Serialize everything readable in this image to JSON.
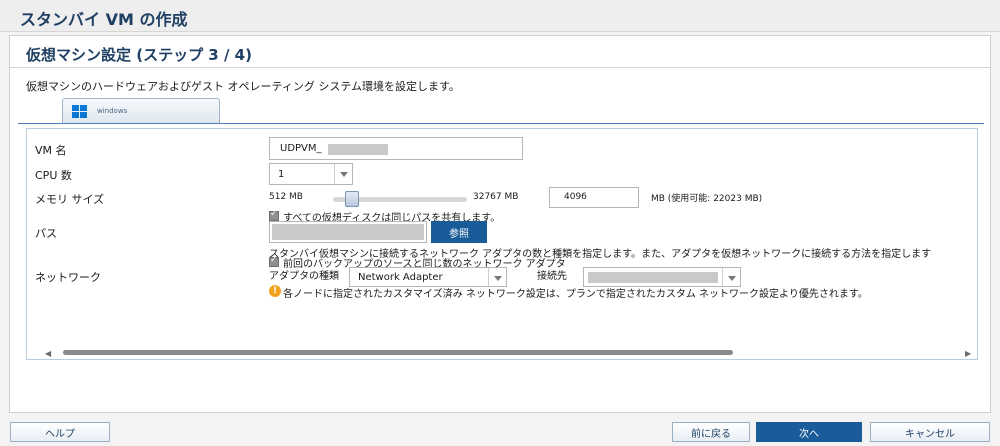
{
  "window": {
    "title": "スタンバイ VM の作成"
  },
  "step": {
    "title": "仮想マシン設定 (ステップ 3 / 4)",
    "description": "仮想マシンのハードウェアおよびゲスト オペレーティング システム環境を設定します。"
  },
  "os_tab": {
    "label": "windows",
    "icon": "windows-icon"
  },
  "form": {
    "vm_name": {
      "label": "VM 名",
      "value": "UDPVM_"
    },
    "cpu": {
      "label": "CPU 数",
      "value": "1"
    },
    "memory": {
      "label": "メモリ サイズ",
      "min": "512 MB",
      "max": "32767 MB",
      "value": "4096",
      "available": "MB (使用可能: 22023 MB)",
      "slider_level_mb": 4096
    },
    "share_path": {
      "label": "すべての仮想ディスクは同じパスを共有します。",
      "checked": true
    },
    "path": {
      "label": "パス",
      "browse": "参照"
    },
    "network": {
      "label": "ネットワーク",
      "description": "スタンバイ仮想マシンに接続するネットワーク アダプタの数と種類を指定します。また、アダプタを仮想ネットワークに接続する方法を指定します",
      "same_as_source": {
        "label": "前回のバックアップのソースと同じ数のネットワーク アダプタ",
        "checked": true
      },
      "adapter_type_label": "アダプタの種類",
      "adapter_type_value": "Network Adapter",
      "connect_to_label": "接続先",
      "warning": "各ノードに指定されたカスタマイズ済み ネットワーク設定は、プランで指定されたカスタム ネットワーク設定より優先されます。",
      "warning_icon": "warning-icon"
    }
  },
  "footer": {
    "help": "ヘルプ",
    "back": "前に戻る",
    "next": "次へ",
    "cancel": "キャンセル"
  },
  "colors": {
    "brand": "#1a5b9a",
    "title": "#1f3f63",
    "warning": "#f2a31e"
  }
}
